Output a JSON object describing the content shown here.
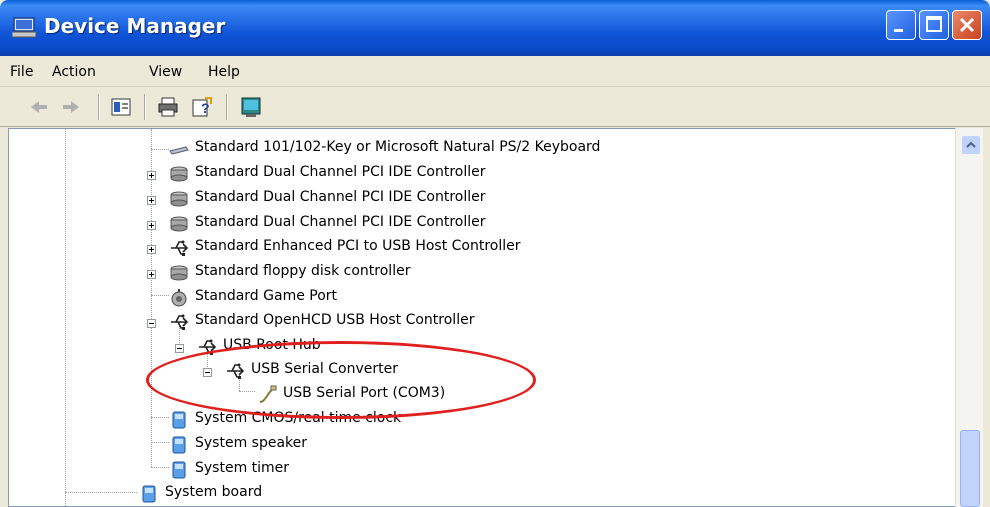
{
  "window": {
    "title": "Device Manager"
  },
  "menu": {
    "items": [
      {
        "label": "File",
        "key": "F"
      },
      {
        "label": "Action",
        "key": "A"
      },
      {
        "label": "View",
        "key": "V"
      },
      {
        "label": "Help",
        "key": "H"
      }
    ]
  },
  "toolbar": {
    "icons": [
      "back-arrow-icon",
      "forward-arrow-icon",
      "properties-icon",
      "print-icon",
      "help-icon",
      "scan-hardware-icon"
    ]
  },
  "tree": {
    "rows": [
      {
        "label": "Standard 101/102-Key or Microsoft Natural PS/2 Keyboard",
        "icon": "keyboard-icon"
      },
      {
        "label": "Standard Dual Channel PCI IDE Controller",
        "icon": "ide-controller-icon"
      },
      {
        "label": "Standard Dual Channel PCI IDE Controller",
        "icon": "ide-controller-icon"
      },
      {
        "label": "Standard Dual Channel PCI IDE Controller",
        "icon": "ide-controller-icon"
      },
      {
        "label": "Standard Enhanced PCI to USB Host Controller",
        "icon": "usb-icon"
      },
      {
        "label": "Standard floppy disk controller",
        "icon": "floppy-controller-icon"
      },
      {
        "label": "Standard Game Port",
        "icon": "game-port-icon"
      },
      {
        "label": "Standard OpenHCD USB Host Controller",
        "icon": "usb-icon"
      },
      {
        "label": "USB Root Hub",
        "icon": "usb-icon"
      },
      {
        "label": "USB Serial Converter",
        "icon": "usb-icon"
      },
      {
        "label": "USB Serial Port (COM3)",
        "icon": "serial-port-icon"
      },
      {
        "label": "System CMOS/real time clock",
        "icon": "system-device-icon"
      },
      {
        "label": "System speaker",
        "icon": "system-device-icon"
      },
      {
        "label": "System timer",
        "icon": "system-device-icon"
      },
      {
        "label": "System board",
        "icon": "system-board-icon"
      }
    ]
  },
  "colors": {
    "titlebar": "#0a4bc8",
    "annotation": "#e0201e",
    "window_bg": "#ece9d8"
  }
}
